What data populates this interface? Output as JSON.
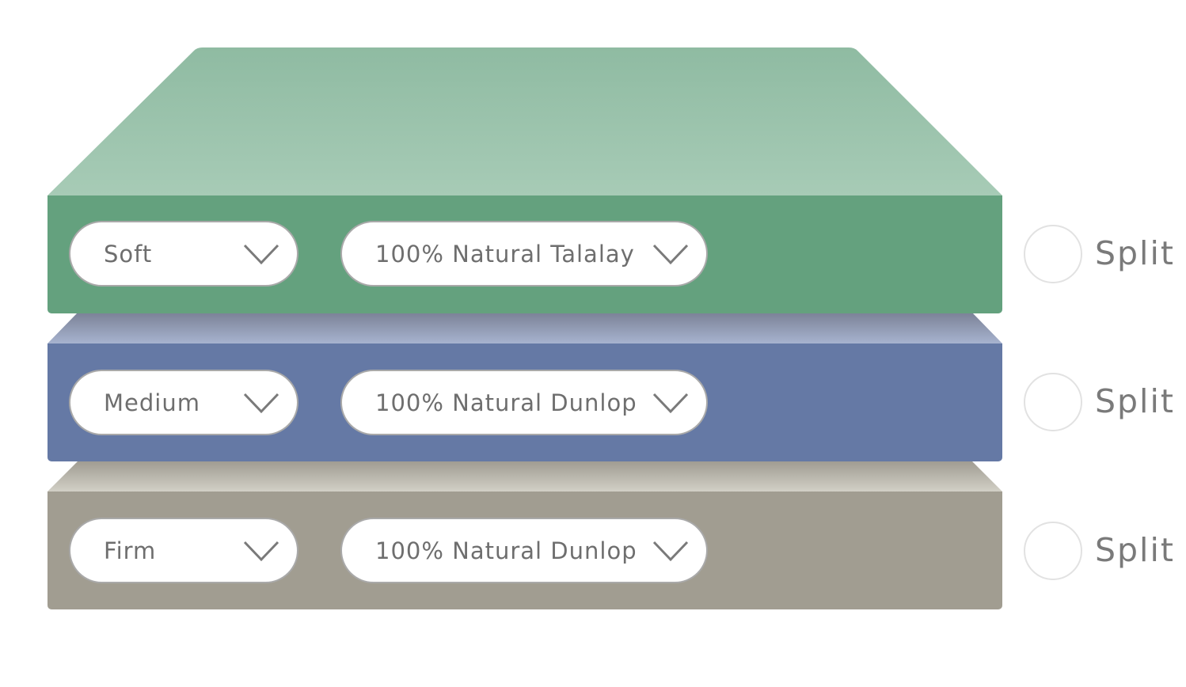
{
  "colors": {
    "soft": "#64a17e",
    "soft_top": "#a6cbb6",
    "medium": "#6579a5",
    "firm": "#a19d91"
  },
  "layers": [
    {
      "firmness": "Soft",
      "material": "100% Natural Talalay",
      "split_label": "Split",
      "split_checked": false
    },
    {
      "firmness": "Medium",
      "material": "100% Natural Dunlop",
      "split_label": "Split",
      "split_checked": false
    },
    {
      "firmness": "Firm",
      "material": "100% Natural Dunlop",
      "split_label": "Split",
      "split_checked": false
    }
  ],
  "icons": {
    "dropdown": "chevron-down-icon",
    "split": "radio-circle"
  }
}
